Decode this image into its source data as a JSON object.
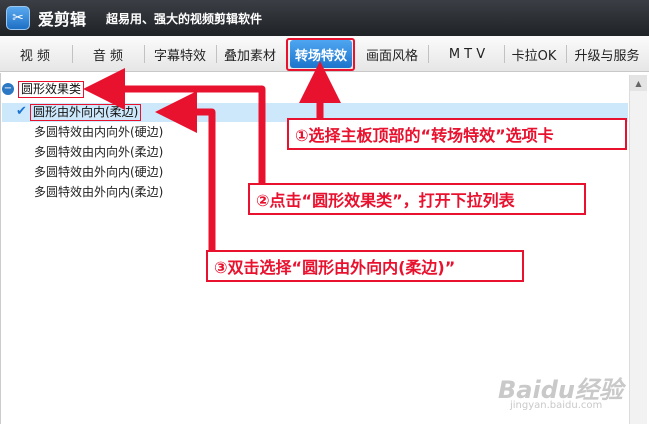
{
  "app": {
    "name": "爱剪辑",
    "tagline": "超易用、强大的视频剪辑软件"
  },
  "tabs": [
    {
      "label": "视 频"
    },
    {
      "label": "音 频"
    },
    {
      "label": "字幕特效"
    },
    {
      "label": "叠加素材"
    },
    {
      "label": "转场特效",
      "active": true
    },
    {
      "label": "画面风格"
    },
    {
      "label": "M T V"
    },
    {
      "label": "卡拉OK"
    },
    {
      "label": "升级与服务"
    }
  ],
  "tree": {
    "category": "圆形效果类",
    "items": [
      {
        "label": "圆形由外向内(柔边)",
        "selected": true
      },
      {
        "label": "多圆特效由内向外(硬边)"
      },
      {
        "label": "多圆特效由内向外(柔边)"
      },
      {
        "label": "多圆特效由外向内(硬边)"
      },
      {
        "label": "多圆特效由外向内(柔边)"
      }
    ]
  },
  "annotations": {
    "step1": "①选择主板顶部的“转场特效”选项卡",
    "step2": "②点击“圆形效果类”，打开下拉列表",
    "step3": "③双击选择“圆形由外向内(柔边)”"
  },
  "watermark": {
    "brand": "Baidu经验",
    "url": "jingyan.baidu.com"
  },
  "colors": {
    "accent_red": "#e8112e",
    "active_tab": "#1c74cc",
    "selection": "#cde8fb"
  }
}
